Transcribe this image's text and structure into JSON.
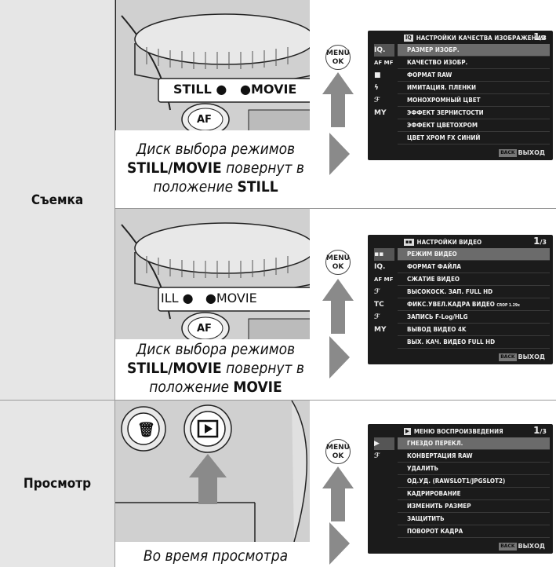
{
  "rows": [
    {
      "label": "Съемка",
      "sub": [
        {
          "dial_left": "STILL",
          "dial_right": "MOVIE",
          "caption_line1": "Диск выбора режимов",
          "caption_bold1": "STILL",
          "caption_slash": "/",
          "caption_bold2": "MOVIE",
          "caption_mid": " повернут в",
          "caption_line3": "положение ",
          "caption_bold3": "STILL",
          "menu_button": "MENU",
          "menu_button2": "OK",
          "screen": {
            "tag": "IQ",
            "title": "НАСТРОЙКИ КАЧЕСТВА ИЗОБРАЖЕНИЯ",
            "page": "1",
            "page_total": "/3",
            "side": [
              "IQ.",
              "AF MF",
              "cam",
              "flash",
              "wrench",
              "MY"
            ],
            "items": [
              "РАЗМЕР ИЗОБР.",
              "КАЧЕСТВО ИЗОБР.",
              "ФОРМАТ RAW",
              "ИМИТАЦИЯ. ПЛЕНКИ",
              "МОНОХРОМНЫЙ ЦВЕТ",
              "ЭФФЕКТ ЗЕРНИСТОСТИ",
              "ЭФФЕКТ ЦВЕТОХРОМ",
              "ЦВЕТ ХРОМ FX СИНИЙ"
            ],
            "back_tag": "BACK",
            "back_label": "ВЫХОД"
          }
        },
        {
          "dial_left": "ILL",
          "dial_right": "MOVIE",
          "caption_line1": "Диск выбора режимов",
          "caption_bold1": "STILL",
          "caption_slash": "/",
          "caption_bold2": "MOVIE",
          "caption_mid": " повернут в",
          "caption_line3": "положение ",
          "caption_bold3": "MOVIE",
          "menu_button": "MENU",
          "menu_button2": "OK",
          "screen": {
            "tag": "movie",
            "title": "НАСТРОЙКИ ВИДЕО",
            "page": "1",
            "page_total": "/3",
            "side": [
              "movie",
              "IQ.",
              "AF MF",
              "wrench",
              "TC",
              "wrench2",
              "MY"
            ],
            "items": [
              "РЕЖИМ ВИДЕО",
              "ФОРМАТ ФАЙЛА",
              "СЖАТИЕ ВИДЕО",
              "ВЫСОКОСК. ЗАП. FULL HD",
              "ФИКС.УВЕЛ.КАДРА ВИДЕО",
              "ЗАПИСЬ F-Log/HLG",
              "ВЫВОД ВИДЕО 4K",
              "ВЫХ. КАЧ. ВИДЕО FULL HD"
            ],
            "crop_badge": "CROP 1.29x",
            "back_tag": "BACK",
            "back_label": "ВЫХОД"
          }
        }
      ]
    },
    {
      "label": "Просмотр",
      "sub": [
        {
          "caption_line1": "Во время просмотра",
          "menu_button": "MENU",
          "menu_button2": "OK",
          "screen": {
            "tag": "play",
            "title": "МЕНЮ ВОСПРОИЗВЕДЕНИЯ",
            "page": "1",
            "page_total": "/3",
            "side": [
              "play",
              "wrench"
            ],
            "items": [
              "ГНЕЗДО ПЕРЕКЛ.",
              "КОНВЕРТАЦИЯ RAW",
              "УДАЛИТЬ",
              "ОД.УД. (RAWSLOT1/JPGSLOT2)",
              "КАДРИРОВАНИЕ",
              "ИЗМЕНИТЬ РАЗМЕР",
              "ЗАЩИТИТЬ",
              "ПОВОРОТ КАДРА"
            ],
            "back_tag": "BACK",
            "back_label": "ВЫХОД"
          }
        }
      ]
    }
  ]
}
